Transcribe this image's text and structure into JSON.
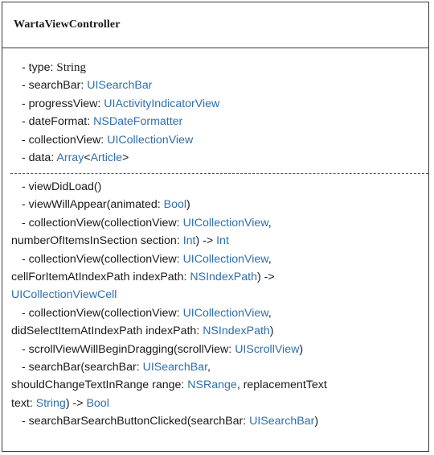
{
  "class_name": "WartaViewController",
  "attributes": [
    {
      "prefix": "- type: ",
      "type": "String"
    },
    {
      "prefix": "- searchBar: ",
      "type": "UISearchBar"
    },
    {
      "prefix": "- progressView: ",
      "type": "UIActivityIndicatorView"
    },
    {
      "prefix": "- dateFormat: ",
      "type": "NSDateFormatter"
    },
    {
      "prefix": "- collectionView: ",
      "type": "UICollectionView"
    },
    {
      "prefix": "- data: ",
      "type": "Array",
      "open": "<",
      "inner": "Article",
      "close": ">"
    }
  ],
  "methods": {
    "m1": "- viewDidLoad()",
    "m2_a": "- viewWillAppear(animated: ",
    "m2_t": "Bool",
    "m2_b": ")",
    "m3_a": "- collectionView(collectionView: ",
    "m3_t1": "UICollectionView",
    "m3_b": ",",
    "m3_c": "numberOfItemsInSection section: ",
    "m3_t2": "Int",
    "m3_d": ") -> ",
    "m3_t3": "Int",
    "m4_a": "- collectionView(collectionView: ",
    "m4_t1": "UICollectionView",
    "m4_b": ",",
    "m4_c": "cellForItemAtIndexPath indexPath: ",
    "m4_t2": "NSIndexPath",
    "m4_d": ") ->",
    "m4_t3": "UICollectionViewCell",
    "m5_a": "- collectionView(collectionView: ",
    "m5_t1": "UICollectionView",
    "m5_b": ",",
    "m5_c": "didSelectItemAtIndexPath indexPath: ",
    "m5_t2": "NSIndexPath",
    "m5_d": ")",
    "m6_a": "- scrollViewWillBeginDragging(scrollView: ",
    "m6_t": "UIScrollView",
    "m6_b": ")",
    "m7_a": "- searchBar(searchBar: ",
    "m7_t1": "UISearchBar",
    "m7_b": ",",
    "m7_c": "shouldChangeTextInRange range: ",
    "m7_t2": "NSRange",
    "m7_d": ", replacementText",
    "m7_e": "text: ",
    "m7_t3": "String",
    "m7_f": ") -> ",
    "m7_t4": "Bool",
    "m8_a": "- searchBarSearchButtonClicked(searchBar: ",
    "m8_t": "UISearchBar",
    "m8_b": ")"
  },
  "colors": {
    "type_color": "#2f6fa9",
    "text_color": "#1a1a1a",
    "border_color": "#3a3a3a"
  }
}
